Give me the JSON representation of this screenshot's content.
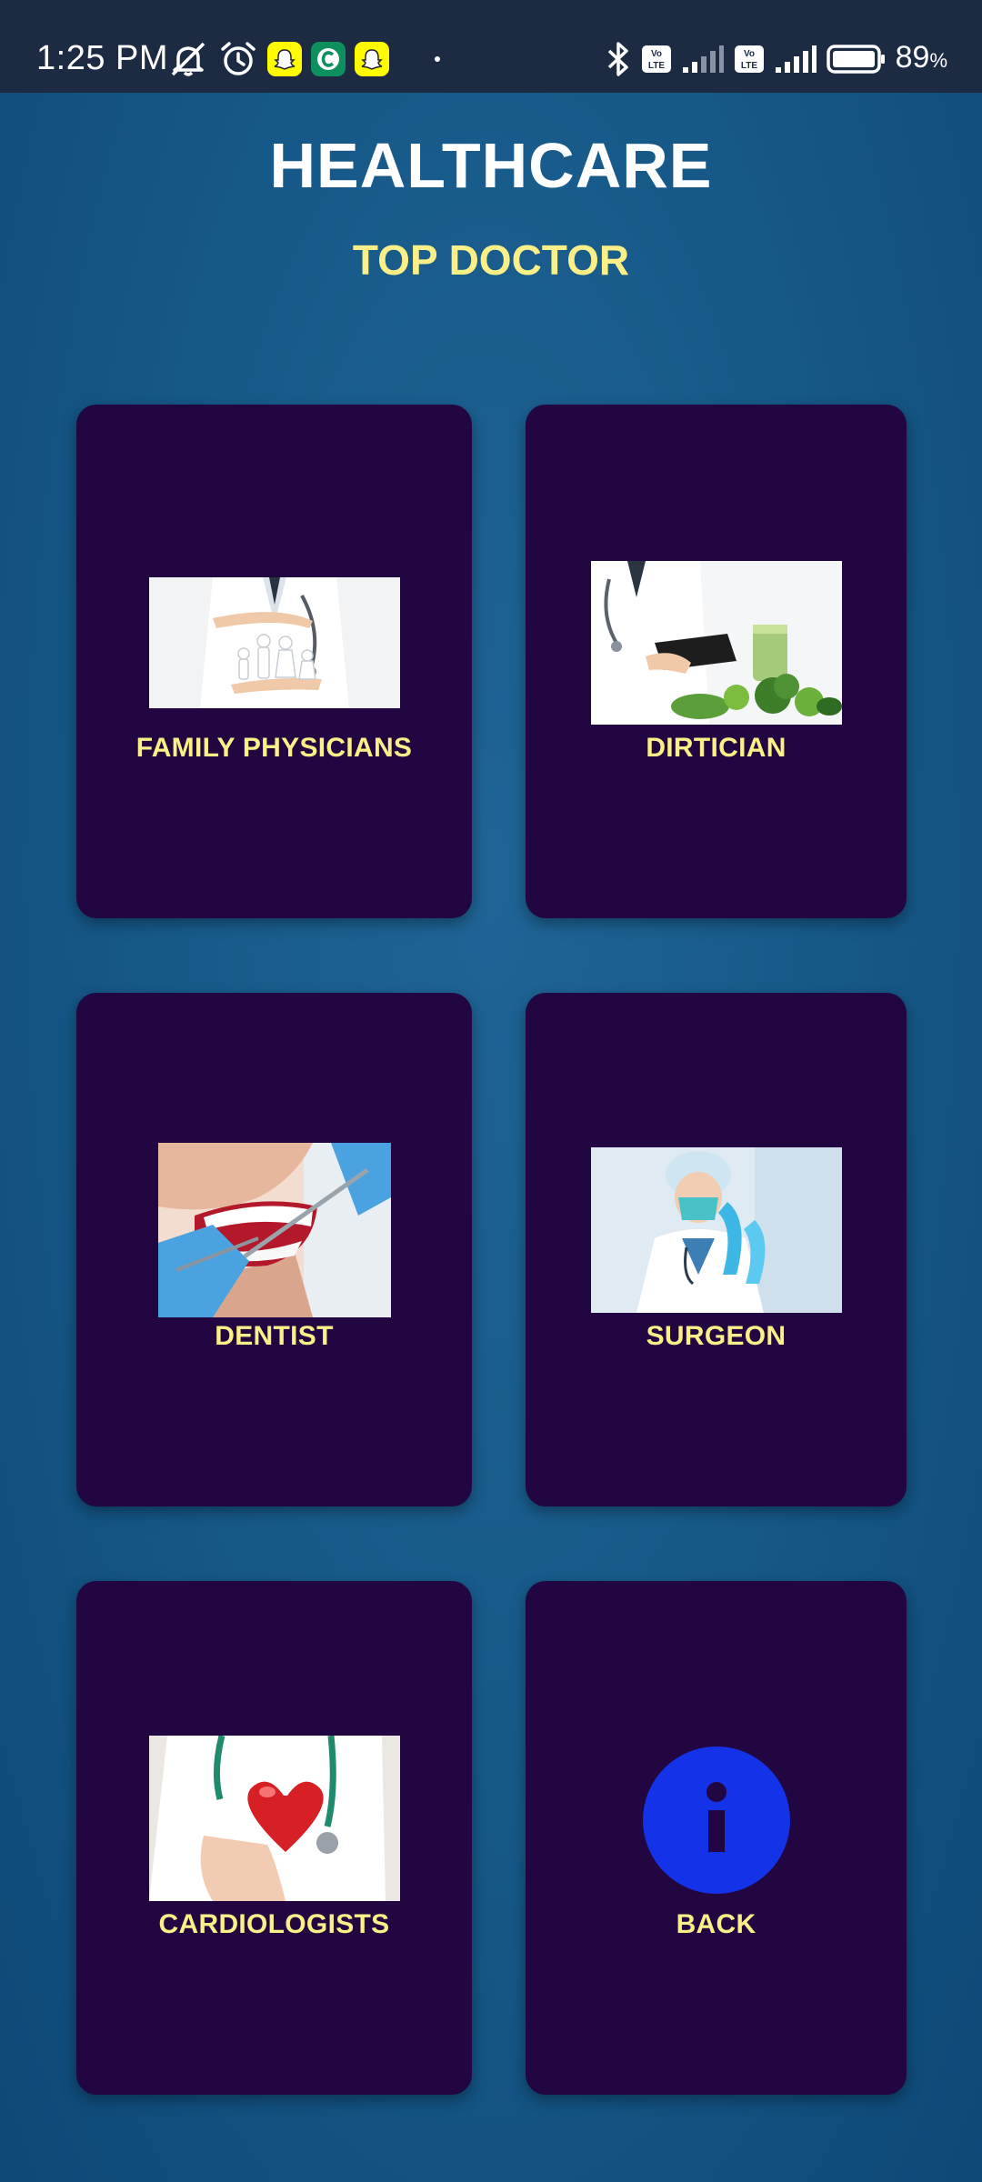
{
  "status_bar": {
    "time": "1:25 PM",
    "battery_percent": "89",
    "battery_symbol": "%",
    "icons": [
      "silent-icon",
      "alarm-icon",
      "snapchat-icon",
      "app-c-icon",
      "snapchat-icon",
      "bluetooth-icon",
      "volte-icon",
      "signal-icon",
      "volte-icon",
      "signal-icon",
      "battery-icon"
    ]
  },
  "header": {
    "title": "HEALTHCARE",
    "subtitle": "TOP DOCTOR"
  },
  "cards": [
    {
      "label": "FAMILY PHYSICIANS",
      "image": "family-physician-image"
    },
    {
      "label": "DIRTICIAN",
      "image": "dietician-image"
    },
    {
      "label": "DENTIST",
      "image": "dentist-image"
    },
    {
      "label": "SURGEON",
      "image": "surgeon-image"
    },
    {
      "label": "CARDIOLOGISTS",
      "image": "cardiologist-image"
    },
    {
      "label": "BACK",
      "image": "info-icon"
    }
  ],
  "colors": {
    "background": "#175a8a",
    "status_bar": "#1c2a42",
    "card": "#210641",
    "title": "#ffffff",
    "label": "#fbf087",
    "info_circle": "#1433e8"
  }
}
